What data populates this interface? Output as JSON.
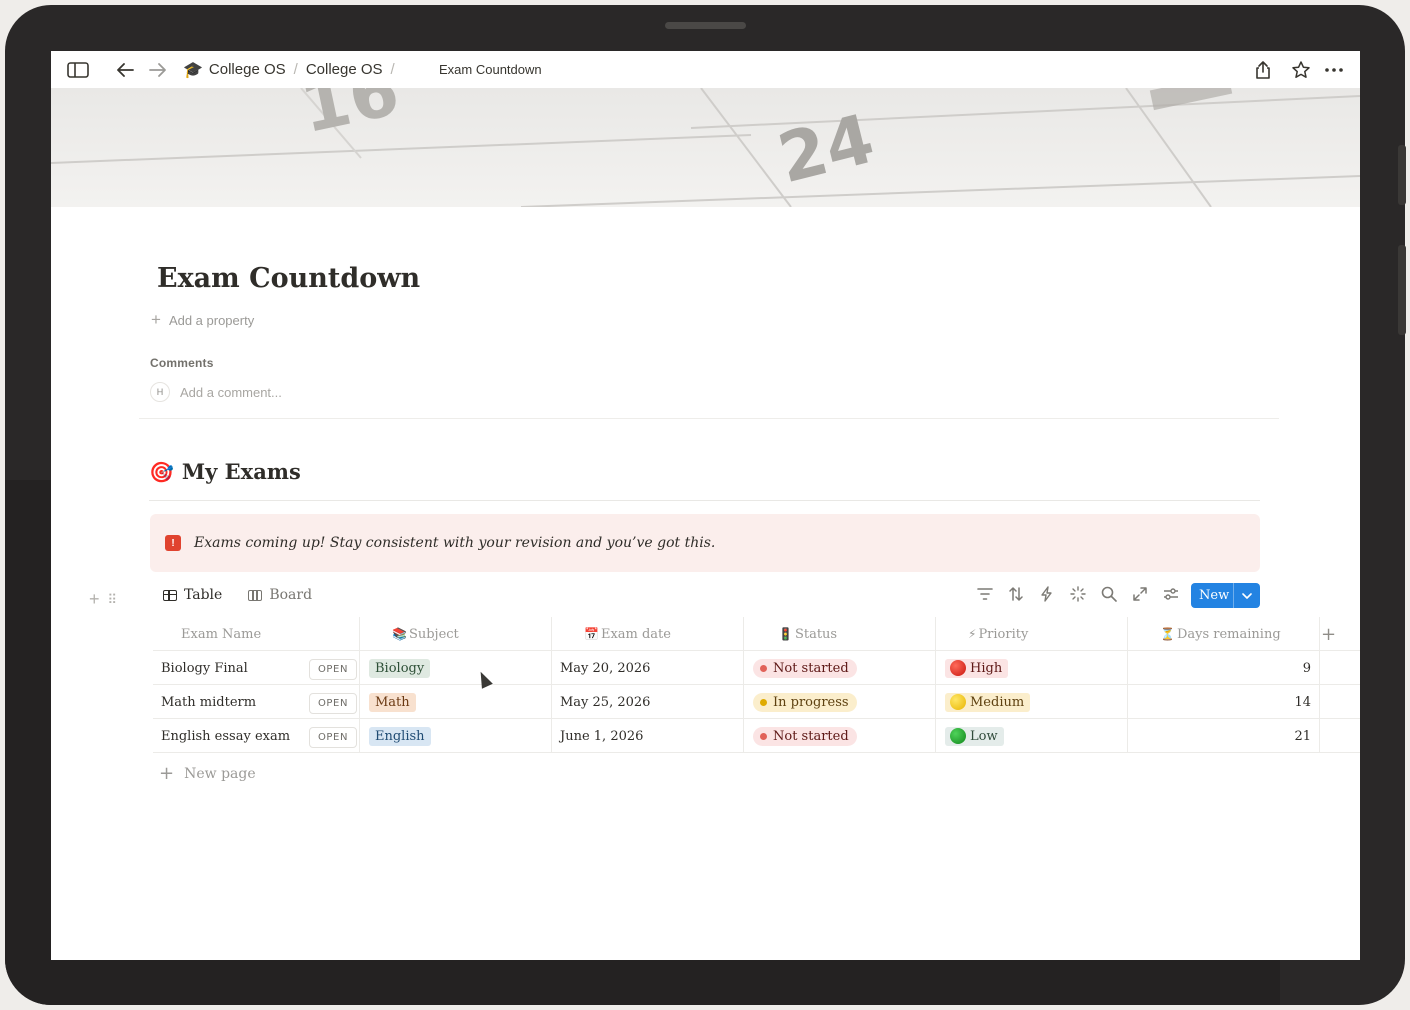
{
  "breadcrumb": {
    "items": [
      "College OS",
      "College OS"
    ],
    "separator": "/",
    "current": "Exam Countdown"
  },
  "cover": {
    "numbers": [
      "16",
      "24"
    ]
  },
  "page": {
    "title": "Exam Countdown",
    "add_property": "Add a property",
    "comments_label": "Comments",
    "avatar_initial": "H",
    "comment_placeholder": "Add a comment..."
  },
  "section": {
    "emoji": "🎯",
    "title": "My Exams",
    "callout_text": "Exams coming up! Stay consistent with your revision and you’ve got this."
  },
  "views": {
    "tabs": [
      {
        "label": "Table",
        "active": true
      },
      {
        "label": "Board",
        "active": false
      }
    ],
    "new_button": "New"
  },
  "table": {
    "columns": [
      "Exam Name",
      "Subject",
      "Exam date",
      "Status",
      "Priority",
      "Days remaining"
    ],
    "open_label": "OPEN",
    "rows": [
      {
        "name": "Biology Final",
        "subject": "Biology",
        "date": "May 20, 2026",
        "status": "Not started",
        "priority": "High",
        "days": "9"
      },
      {
        "name": "Math midterm",
        "subject": "Math",
        "date": "May 25, 2026",
        "status": "In progress",
        "priority": "Medium",
        "days": "14"
      },
      {
        "name": "English essay exam",
        "subject": "English",
        "date": "June 1, 2026",
        "status": "Not started",
        "priority": "Low",
        "days": "21"
      }
    ],
    "new_page": "New page"
  },
  "colors": {
    "accent_blue": "#2383e2",
    "callout_bg": "#fbeeec",
    "status_not_started_bg": "#fbe4e4",
    "status_in_progress_bg": "#fbeecc",
    "tag_biology_bg": "#dfe9e1",
    "tag_math_bg": "#f8e1cf",
    "tag_english_bg": "#d8e6f3"
  }
}
